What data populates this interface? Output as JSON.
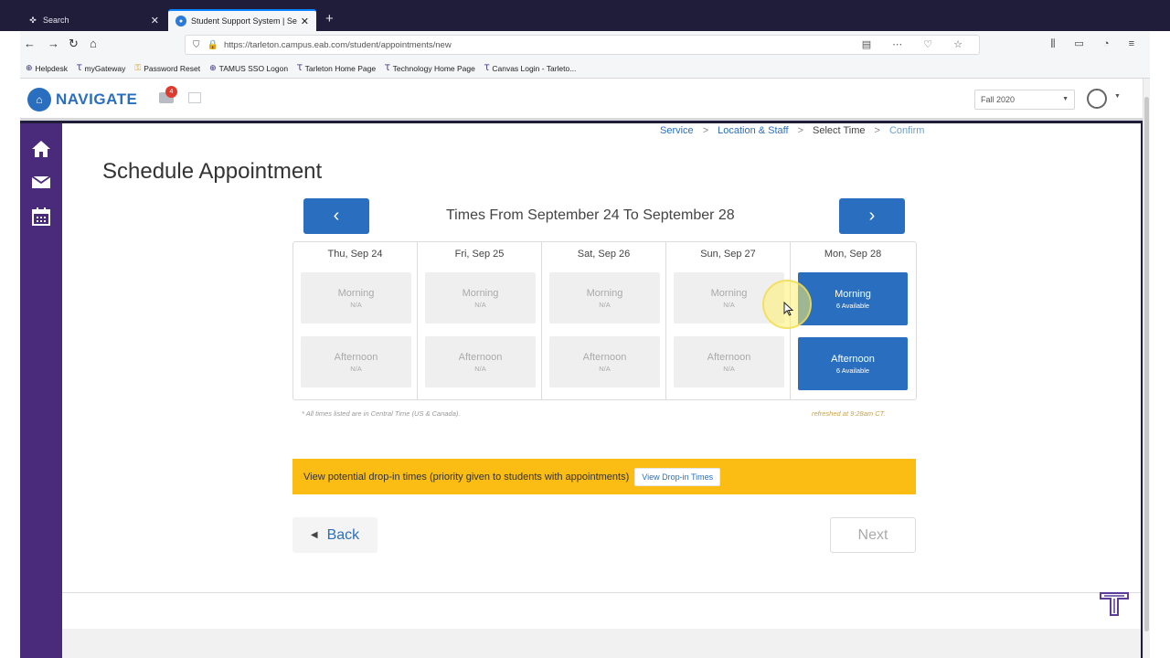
{
  "browser": {
    "tabs": [
      {
        "title": "Search",
        "active": false
      },
      {
        "title": "Student Support System | Sele",
        "active": true
      }
    ],
    "url": "https://tarleton.campus.eab.com/student/appointments/new",
    "bookmarks": [
      "Helpdesk",
      "myGateway",
      "Password Reset",
      "TAMUS SSO Logon",
      "Tarleton Home Page",
      "Technology Home Page",
      "Canvas Login - Tarleto..."
    ]
  },
  "app": {
    "logo_text": "NAVIGATE",
    "notification_count": "4",
    "term": "Fall 2020"
  },
  "breadcrumb": {
    "steps": [
      "Service",
      "Location & Staff",
      "Select Time",
      "Confirm"
    ],
    "current_index": 2
  },
  "page": {
    "title": "Schedule Appointment",
    "range_label": "Times From September 24 To September 28",
    "prev_label": "‹",
    "next_label": "›"
  },
  "days": [
    {
      "label": "Thu, Sep 24",
      "slots": [
        {
          "name": "Morning",
          "status": "N/A",
          "available": false
        },
        {
          "name": "Afternoon",
          "status": "N/A",
          "available": false
        }
      ]
    },
    {
      "label": "Fri, Sep 25",
      "slots": [
        {
          "name": "Morning",
          "status": "N/A",
          "available": false
        },
        {
          "name": "Afternoon",
          "status": "N/A",
          "available": false
        }
      ]
    },
    {
      "label": "Sat, Sep 26",
      "slots": [
        {
          "name": "Morning",
          "status": "N/A",
          "available": false
        },
        {
          "name": "Afternoon",
          "status": "N/A",
          "available": false
        }
      ]
    },
    {
      "label": "Sun, Sep 27",
      "slots": [
        {
          "name": "Morning",
          "status": "N/A",
          "available": false
        },
        {
          "name": "Afternoon",
          "status": "N/A",
          "available": false
        }
      ]
    },
    {
      "label": "Mon, Sep 28",
      "slots": [
        {
          "name": "Morning",
          "status": "6 Available",
          "available": true
        },
        {
          "name": "Afternoon",
          "status": "6 Available",
          "available": true
        }
      ]
    }
  ],
  "notes": {
    "timezone": "* All times listed are in Central Time (US & Canada).",
    "refreshed": "refreshed at 9:28am CT."
  },
  "banner": {
    "text": "View potential drop-in times (priority given to students with appointments)",
    "button": "View Drop-in Times"
  },
  "footer_buttons": {
    "back": "Back",
    "next": "Next"
  },
  "colors": {
    "primary": "#2a6fbf",
    "sidebar": "#4a2a7a",
    "banner": "#fbbc13"
  }
}
